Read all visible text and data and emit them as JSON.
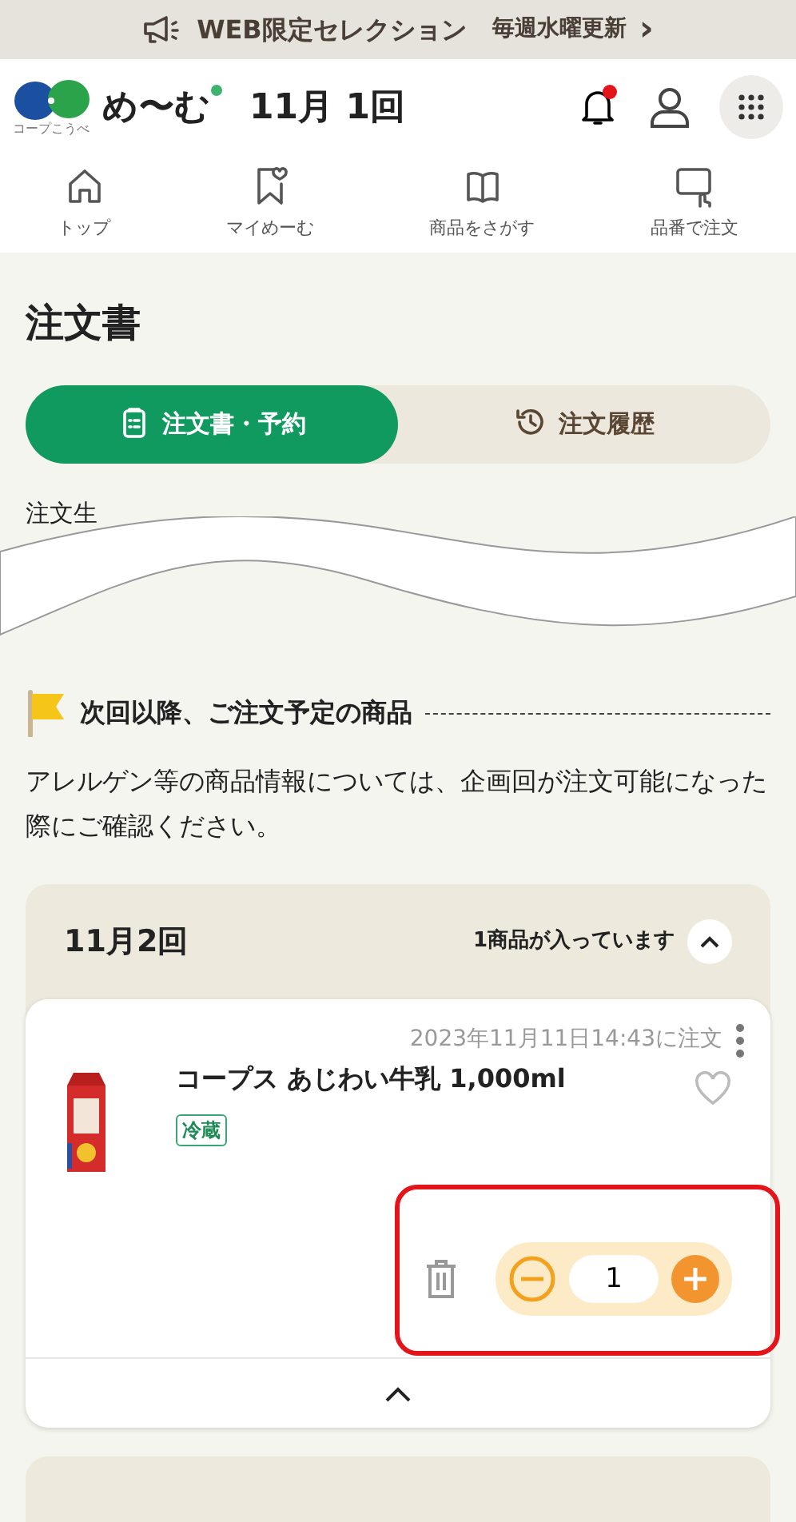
{
  "banner": {
    "text": "WEB限定セレクション",
    "link": "毎週水曜更新",
    "chevron": "›"
  },
  "header": {
    "logo_caption": "コープこうべ",
    "brand": "め〜む",
    "round": "11月 1回",
    "notification_unread": true
  },
  "nav": [
    {
      "label": "トップ",
      "kind": "home"
    },
    {
      "label": "マイめーむ",
      "kind": "favorite"
    },
    {
      "label": "商品をさがす",
      "kind": "book"
    },
    {
      "label": "品番で注文",
      "kind": "number"
    }
  ],
  "page_title": "注文書",
  "tabs": [
    {
      "label": "注文書・予約",
      "kind": "clipboard",
      "selected": true
    },
    {
      "label": "注文履歴",
      "kind": "history",
      "selected": false
    }
  ],
  "partial_text": "注文生",
  "section_heading": "次回以降、ご注文予定の商品",
  "note": "アレルゲン等の商品情報については、企画回が注文可能になった際にご確認ください。",
  "groups": [
    {
      "title": "11月2回",
      "count": "1商品が入っています",
      "expanded": true,
      "items": [
        {
          "ordered_at": "2023年11月11日14:43に注文",
          "name": "コープス あじわい牛乳 1,000ml",
          "tag": "冷蔵",
          "quantity": "1",
          "favorite": false,
          "highlighted": true
        }
      ]
    }
  ]
}
